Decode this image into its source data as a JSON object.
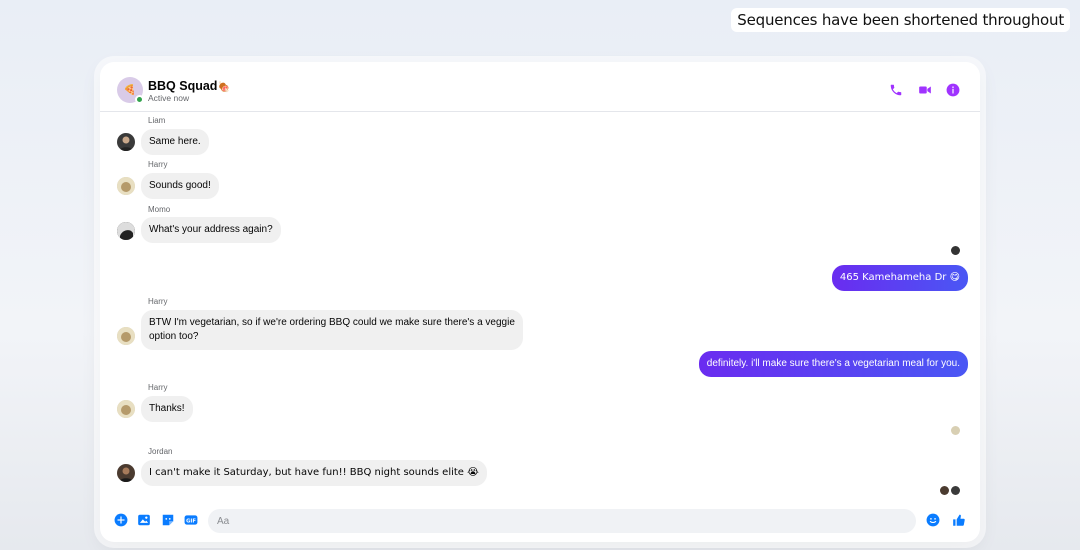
{
  "caption": "Sequences have been shortened throughout",
  "header": {
    "title": "BBQ Squad",
    "title_emoji": "🍖",
    "status": "Active now",
    "group_avatar_emoji": "🍕"
  },
  "messages": [
    {
      "sender": "Liam",
      "text": "Same here.",
      "direction": "in"
    },
    {
      "sender": "Harry",
      "text": "Sounds good!",
      "direction": "in"
    },
    {
      "sender": "Momo",
      "text": "What's your address again?",
      "direction": "in"
    },
    {
      "sender": "",
      "text": "465 Kamehameha Dr 😋",
      "direction": "out"
    },
    {
      "sender": "Harry",
      "text_line1": "BTW I'm vegetarian, so if we're ordering BBQ could we make sure there's a veggie",
      "text_line2": "option too?",
      "direction": "in"
    },
    {
      "sender": "",
      "text": "definitely. i'll make sure there's a vegetarian meal for you.",
      "direction": "out"
    },
    {
      "sender": "Harry",
      "text": "Thanks!",
      "direction": "in"
    },
    {
      "sender": "Jordan",
      "text": "I can't make it Saturday, but have fun!! BBQ night sounds elite 😭",
      "direction": "in"
    }
  ],
  "composer": {
    "placeholder": "Aa"
  },
  "colors": {
    "accent": "#a033ff",
    "outgoing_bubble": "#5b3bf5",
    "incoming_bubble": "#f0f0f0",
    "composer_icon": "#0a7cff",
    "online": "#31a24c"
  },
  "icons": {
    "call": "phone-icon",
    "video": "video-camera-icon",
    "info": "info-icon",
    "plus": "plus-circle-icon",
    "photo": "image-icon",
    "sticker": "sticker-icon",
    "gif": "gif-icon",
    "emoji": "smiley-icon",
    "like": "thumbs-up-icon"
  }
}
